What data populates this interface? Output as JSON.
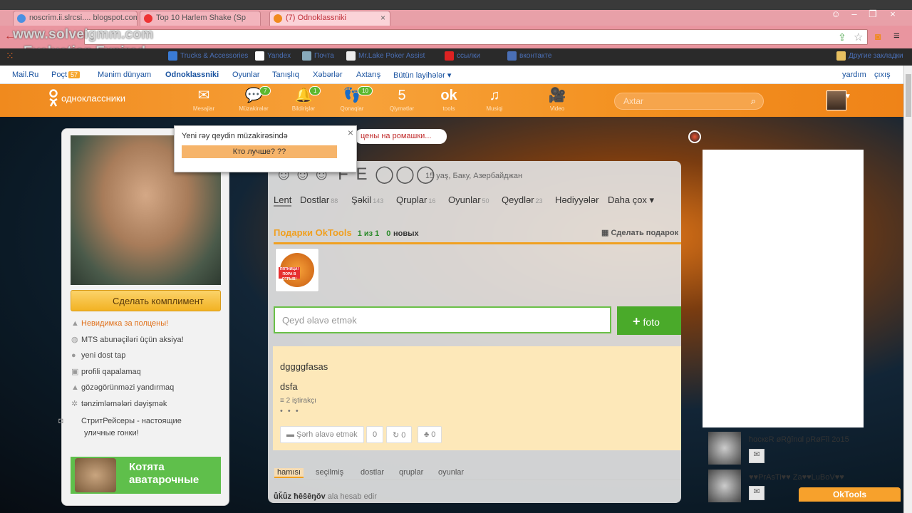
{
  "browser": {
    "tabs": [
      {
        "label": "rюscrim.ii.slrcsi.... blogspot.com"
      },
      {
        "label": "Top 10 Harlem Shake (Sp"
      },
      {
        "label": "(7) Odnoklassniki"
      }
    ],
    "watermark_line1": "www.solveigmm.com",
    "watermark_line2": "Evaluation Expired",
    "bookmarks": [
      {
        "label": "Trucks & Accessories"
      },
      {
        "label": "Yandex"
      },
      {
        "label": "Почта"
      },
      {
        "label": "Mr.Lake Poker Assist"
      },
      {
        "label": "ссылки"
      },
      {
        "label": "вконтакте"
      },
      {
        "label": "Другие закладки"
      }
    ]
  },
  "mailru": {
    "links": [
      "Mail.Ru",
      "Poçt",
      "Mənim dünyam",
      "Odnoklassniki",
      "Oyunlar",
      "Tanışlıq",
      "Xəbərlər",
      "Axtarış",
      "Bütün layihələr ▾"
    ],
    "mail_count": "57",
    "right_links": [
      "yardım",
      "çıxış"
    ]
  },
  "okbar": {
    "logo": "одноклассники",
    "nav": [
      {
        "label": "Mesajlar",
        "glyph": "✉",
        "count": ""
      },
      {
        "label": "Müzakirələr",
        "glyph": "💬",
        "count": "7"
      },
      {
        "label": "Bildirişlər",
        "glyph": "🔔",
        "count": "1"
      },
      {
        "label": "Qonaqlar",
        "glyph": "👣",
        "count": "10"
      },
      {
        "label": "Qiymətlər",
        "glyph": "5",
        "count": ""
      },
      {
        "label": "tools",
        "glyph": "ok",
        "count": ""
      },
      {
        "label": "Musiqi",
        "glyph": "♫",
        "count": ""
      },
      {
        "label": "Video",
        "glyph": "🎥",
        "count": ""
      }
    ],
    "search_placeholder": "Axtar"
  },
  "popup": {
    "title": "Yeni rəy qeydin müzakirəsində",
    "item": "Кто лучше? ??",
    "pill": "цены на ромашки..."
  },
  "profile": {
    "name": "☺☺☺ F E ◯◯◯",
    "age": "15 yaş, Баку, Азербайджан",
    "tabs": [
      {
        "label": "Lent",
        "n": ""
      },
      {
        "label": "Dostlar",
        "n": "88"
      },
      {
        "label": "Şəkil",
        "n": "143"
      },
      {
        "label": "Qruplar",
        "n": "16"
      },
      {
        "label": "Oyunlar",
        "n": "50"
      },
      {
        "label": "Qeydlər",
        "n": "23"
      },
      {
        "label": "Hədiyyələr",
        "n": ""
      },
      {
        "label": "Daha çox ▾",
        "n": ""
      }
    ],
    "gifts_title": "Подарки OkTools",
    "gifts_count": "1 из 1",
    "gifts_new": "0",
    "gifts_new_label": "новых",
    "gift_button": "Сделать подарок",
    "gift_sign": "ПЯТНИЦА! ПОРА В ОТРЫВ!",
    "note_placeholder": "Qeyd əlavə etmək",
    "foto": "foto"
  },
  "post": {
    "line1": "dggggfasas",
    "line2": "dsfa",
    "participants": "2 iştirakçı",
    "dots": "• • •",
    "comment": "Şərh əlavə etmək",
    "comment_count": "0",
    "share_count": "0",
    "like_count": "0"
  },
  "feed": {
    "tabs": [
      "hamısı",
      "seçilmiş",
      "dostlar",
      "qruplar",
      "oyunlar"
    ],
    "item_name": "ǖǩǖz ħȇŝȇŋǒv",
    "item_text": "ala hesab edir"
  },
  "left": {
    "compliment": "Сделать комплимент",
    "items": [
      {
        "label": "Невидимка за полцены!",
        "icon": "hat-icon"
      },
      {
        "label": "MTS abunəçiləri üçün aksiya!",
        "icon": "globe-icon"
      },
      {
        "label": "yeni dost tap",
        "icon": "user-icon"
      },
      {
        "label": "profili qapalamaq",
        "icon": "lock-icon"
      },
      {
        "label": "gözəgörünməzi yandırmaq",
        "icon": "hat-icon"
      },
      {
        "label": "tənzimləmələri dəyişmək",
        "icon": "gear-icon"
      },
      {
        "label": "СтритРейсеры - настоящие уличные гонки!",
        "icon": "gamepad-icon"
      }
    ],
    "kittens_line1": "Котята",
    "kittens_line2": "аватарочные"
  },
  "right": {
    "friends": [
      {
        "name": "ħɑcкɛR øRĝȋnɑl pRøFȋl 2o15"
      },
      {
        "name": "♥♥PrAsTi♥♥ Za♥♥LuBoV♥♥"
      }
    ],
    "oktools": "OkTools"
  },
  "colors": {
    "ok_orange": "#f08a1e",
    "green": "#4aaa2a",
    "link": "#1a53a0"
  }
}
